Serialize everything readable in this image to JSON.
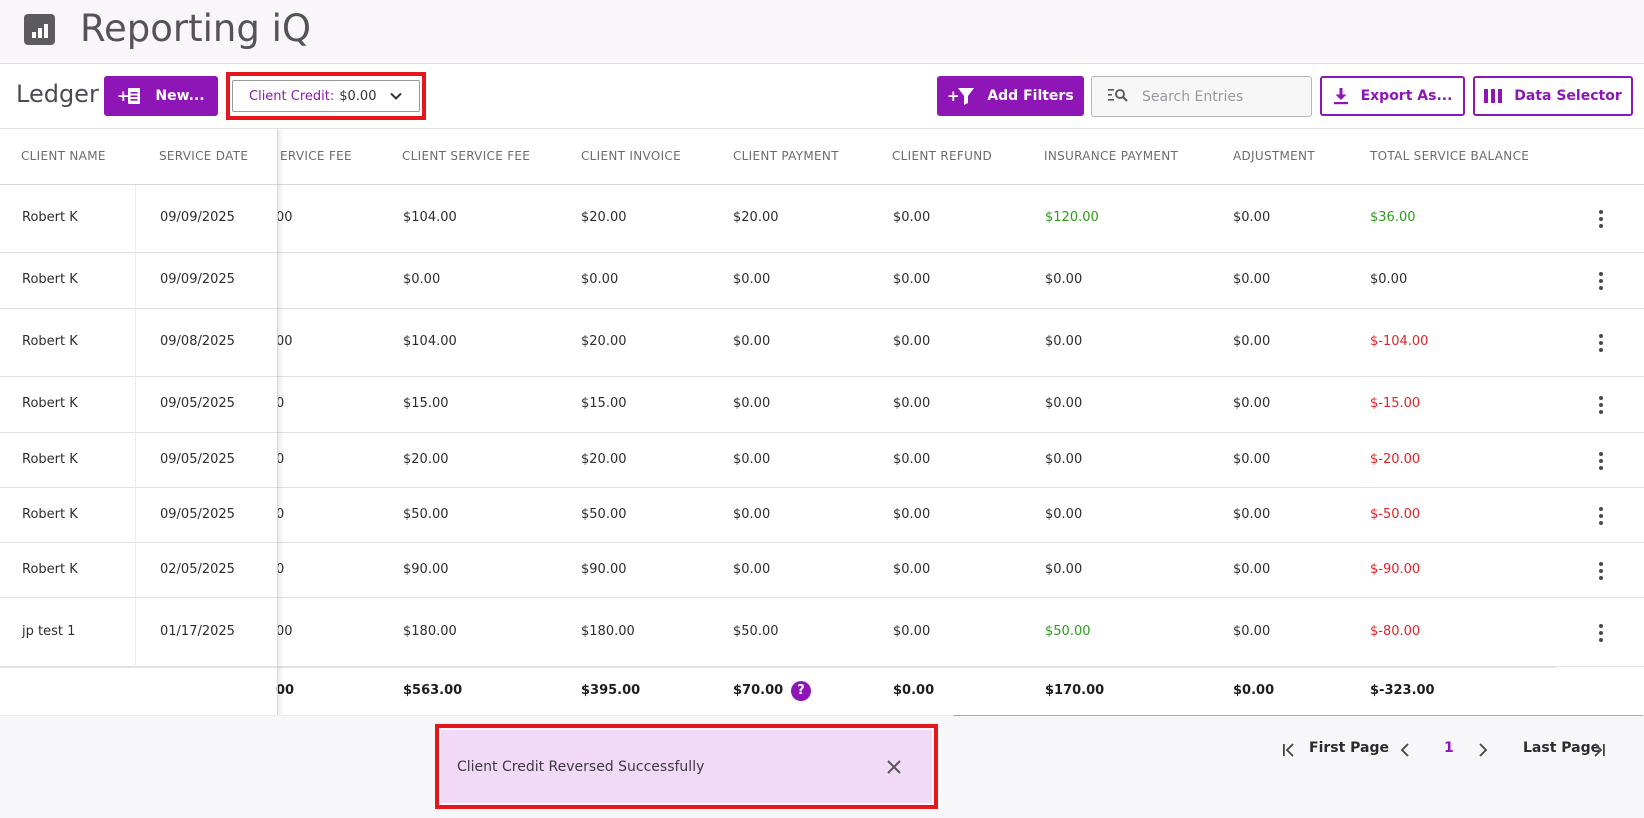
{
  "app": {
    "title": "Reporting iQ",
    "logo_icon": "bar-chart-icon"
  },
  "toolbar": {
    "ledger_label": "Ledger",
    "new_button": "New...",
    "client_credit_label": "Client Credit:",
    "client_credit_value": "$0.00",
    "add_filters_button": "Add Filters",
    "search_placeholder": "Search Entries",
    "export_button": "Export As...",
    "data_selector_button": "Data Selector"
  },
  "table": {
    "columns": [
      "CLIENT NAME",
      "SERVICE DATE",
      "ERVICE FEE",
      "CLIENT SERVICE FEE",
      "CLIENT INVOICE",
      "CLIENT PAYMENT",
      "CLIENT REFUND",
      "INSURANCE PAYMENT",
      "ADJUSTMENT",
      "TOTAL SERVICE BALANCE"
    ],
    "rows": [
      {
        "client": "Robert K",
        "date": "09/09/2025",
        "service_fee": "00",
        "client_service_fee": "$104.00",
        "invoice": "$20.00",
        "payment": "$20.00",
        "refund": "$0.00",
        "insurance": "$120.00",
        "adjustment": "$0.00",
        "balance": "$36.00"
      },
      {
        "client": "Robert K",
        "date": "09/09/2025",
        "service_fee": "",
        "client_service_fee": "$0.00",
        "invoice": "$0.00",
        "payment": "$0.00",
        "refund": "$0.00",
        "insurance": "$0.00",
        "adjustment": "$0.00",
        "balance": "$0.00"
      },
      {
        "client": "Robert K",
        "date": "09/08/2025",
        "service_fee": "00",
        "client_service_fee": "$104.00",
        "invoice": "$20.00",
        "payment": "$0.00",
        "refund": "$0.00",
        "insurance": "$0.00",
        "adjustment": "$0.00",
        "balance": "$-104.00"
      },
      {
        "client": "Robert K",
        "date": "09/05/2025",
        "service_fee": "0",
        "client_service_fee": "$15.00",
        "invoice": "$15.00",
        "payment": "$0.00",
        "refund": "$0.00",
        "insurance": "$0.00",
        "adjustment": "$0.00",
        "balance": "$-15.00"
      },
      {
        "client": "Robert K",
        "date": "09/05/2025",
        "service_fee": "0",
        "client_service_fee": "$20.00",
        "invoice": "$20.00",
        "payment": "$0.00",
        "refund": "$0.00",
        "insurance": "$0.00",
        "adjustment": "$0.00",
        "balance": "$-20.00"
      },
      {
        "client": "Robert K",
        "date": "09/05/2025",
        "service_fee": "0",
        "client_service_fee": "$50.00",
        "invoice": "$50.00",
        "payment": "$0.00",
        "refund": "$0.00",
        "insurance": "$0.00",
        "adjustment": "$0.00",
        "balance": "$-50.00"
      },
      {
        "client": "Robert K",
        "date": "02/05/2025",
        "service_fee": "0",
        "client_service_fee": "$90.00",
        "invoice": "$90.00",
        "payment": "$0.00",
        "refund": "$0.00",
        "insurance": "$0.00",
        "adjustment": "$0.00",
        "balance": "$-90.00"
      },
      {
        "client": "jp test 1",
        "date": "01/17/2025",
        "service_fee": "00",
        "client_service_fee": "$180.00",
        "invoice": "$180.00",
        "payment": "$50.00",
        "refund": "$0.00",
        "insurance": "$50.00",
        "adjustment": "$0.00",
        "balance": "$-80.00"
      }
    ],
    "totals": {
      "service_fee": "00",
      "client_service_fee": "$563.00",
      "invoice": "$395.00",
      "payment": "$70.00",
      "refund": "$0.00",
      "insurance": "$170.00",
      "adjustment": "$0.00",
      "balance": "$-323.00"
    }
  },
  "toast": {
    "message": "Client Credit Reversed Successfully"
  },
  "pagination": {
    "first_label": "First Page",
    "current_page": "1",
    "last_label": "Last Page"
  },
  "colors": {
    "accent": "#8e16b6",
    "positive": "#2f9a1d",
    "negative": "#e0242a",
    "highlight": "#e3171d",
    "toast_bg": "#f3d9f8"
  }
}
